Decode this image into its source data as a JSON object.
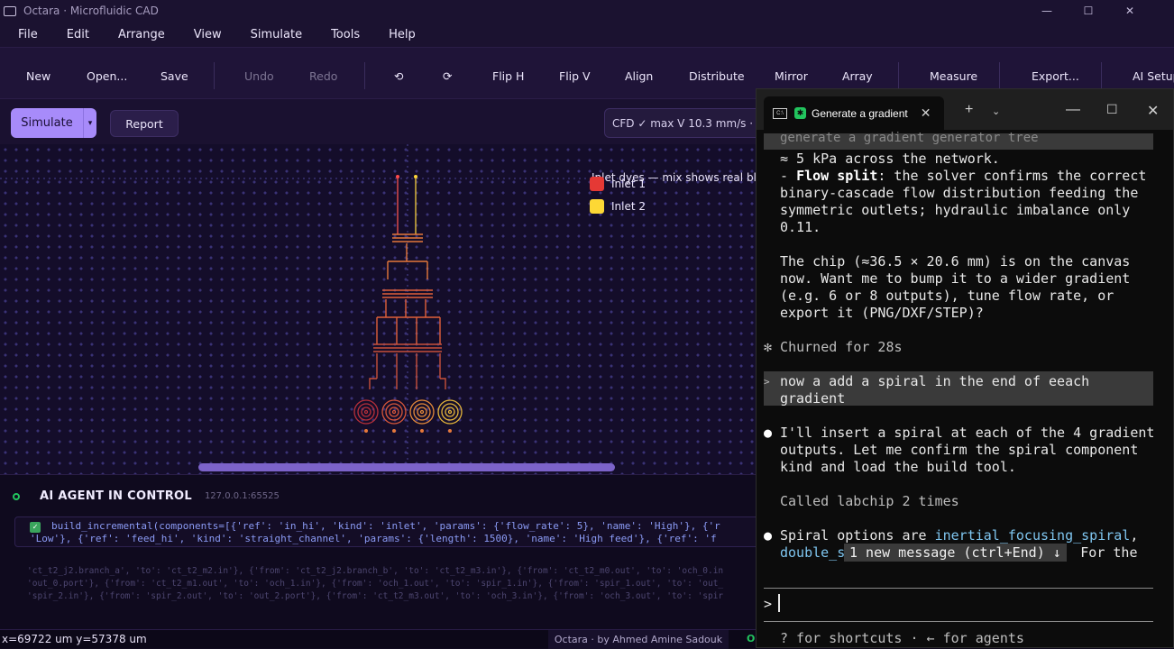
{
  "window": {
    "title": "Octara · Microfluidic CAD"
  },
  "menu": [
    "File",
    "Edit",
    "Arrange",
    "View",
    "Simulate",
    "Tools",
    "Help"
  ],
  "toolbar": {
    "new": "New",
    "open": "Open...",
    "save": "Save",
    "undo": "Undo",
    "redo": "Redo",
    "rotate_ccw": "⟲",
    "rotate_cw": "⟳",
    "flip_h": "Flip H",
    "flip_v": "Flip V",
    "align": "Align",
    "distribute": "Distribute",
    "mirror": "Mirror",
    "array": "Array",
    "measure": "Measure",
    "export": "Export...",
    "ai_setup": "AI Setup"
  },
  "actions": {
    "simulate": "Simulate",
    "simulate_dropdown": "▾",
    "report": "Report",
    "cfd_status": "CFD ✓  max V 10.3 mm/s · cre"
  },
  "legend": {
    "title": "Inlet dyes — mix shows real ble",
    "items": [
      {
        "label": "Inlet 1",
        "color": "#e53935"
      },
      {
        "label": "Inlet 2",
        "color": "#fdd835"
      }
    ]
  },
  "agent": {
    "title": "AI AGENT IN CONTROL",
    "address": "127.0.0.1:65525",
    "log_line1": "build_incremental(components=[{'ref': 'in_hi', 'kind': 'inlet', 'params': {'flow_rate': 5}, 'name': 'High'}, {'r",
    "log_line2": "'Low'}, {'ref': 'feed_hi', 'kind': 'straight_channel', 'params': {'length': 1500}, 'name': 'High feed'}, {'ref': 'f",
    "tail": [
      "'ct_t2_j2.branch_a', 'to': 'ct_t2_m2.in'}, {'from': 'ct_t2_j2.branch_b', 'to': 'ct_t2_m3.in'}, {'from': 'ct_t2_m0.out', 'to': 'och_0.in",
      "'out_0.port'}, {'from': 'ct_t2_m1.out', 'to': 'och_1.in'}, {'from': 'och_1.out', 'to': 'spir_1.in'}, {'from': 'spir_1.out', 'to': 'out_",
      "'spir_2.in'}, {'from': 'spir_2.out', 'to': 'out_2.port'}, {'from': 'ct_t2_m3.out', 'to': 'och_3.in'}, {'from': 'och_3.out', 'to': 'spir"
    ]
  },
  "status": {
    "coords": "x=69722 um  y=57378 um",
    "credit": "Octara · by Ahmed Amine Sadouk",
    "oc": "O"
  },
  "terminal": {
    "tab_title": "Generate a gradient",
    "top_partial": "generate a gradient generator tree",
    "lines": {
      "l1": "≈ 5 kPa across the network.",
      "l2a": "- ",
      "l2b": "Flow split",
      "l2c": ": the solver confirms the correct",
      "l3": "binary-cascade flow distribution feeding the",
      "l4": "symmetric outlets; hydraulic imbalance only",
      "l5": "0.11.",
      "l6": "The chip (≈36.5 × 20.6 mm) is on the canvas",
      "l7": "now. Want me to bump it to a wider gradient",
      "l8": "(e.g. 6 or 8 outputs), tune flow rate, or",
      "l9": "export it (PNG/DXF/STEP)?",
      "churned": "✻ Churned for 28s",
      "user1": "now a add a spiral in the end of eeach",
      "user2": "gradient",
      "a1": "I'll insert a spiral at each of the 4 gradient",
      "a2": "outputs. Let me confirm the spiral component",
      "a3": "kind and load the build tool.",
      "called": "Called labchip 2 times",
      "s1a": "Spiral options are ",
      "s1b": "inertial_focusing_spiral",
      "s1c": ",",
      "s2a": "double_s",
      "s2c": " For the"
    },
    "new_message": "1 new message (ctrl+End) ↓",
    "prompt": ">",
    "hint": "? for shortcuts · ← for agents"
  }
}
